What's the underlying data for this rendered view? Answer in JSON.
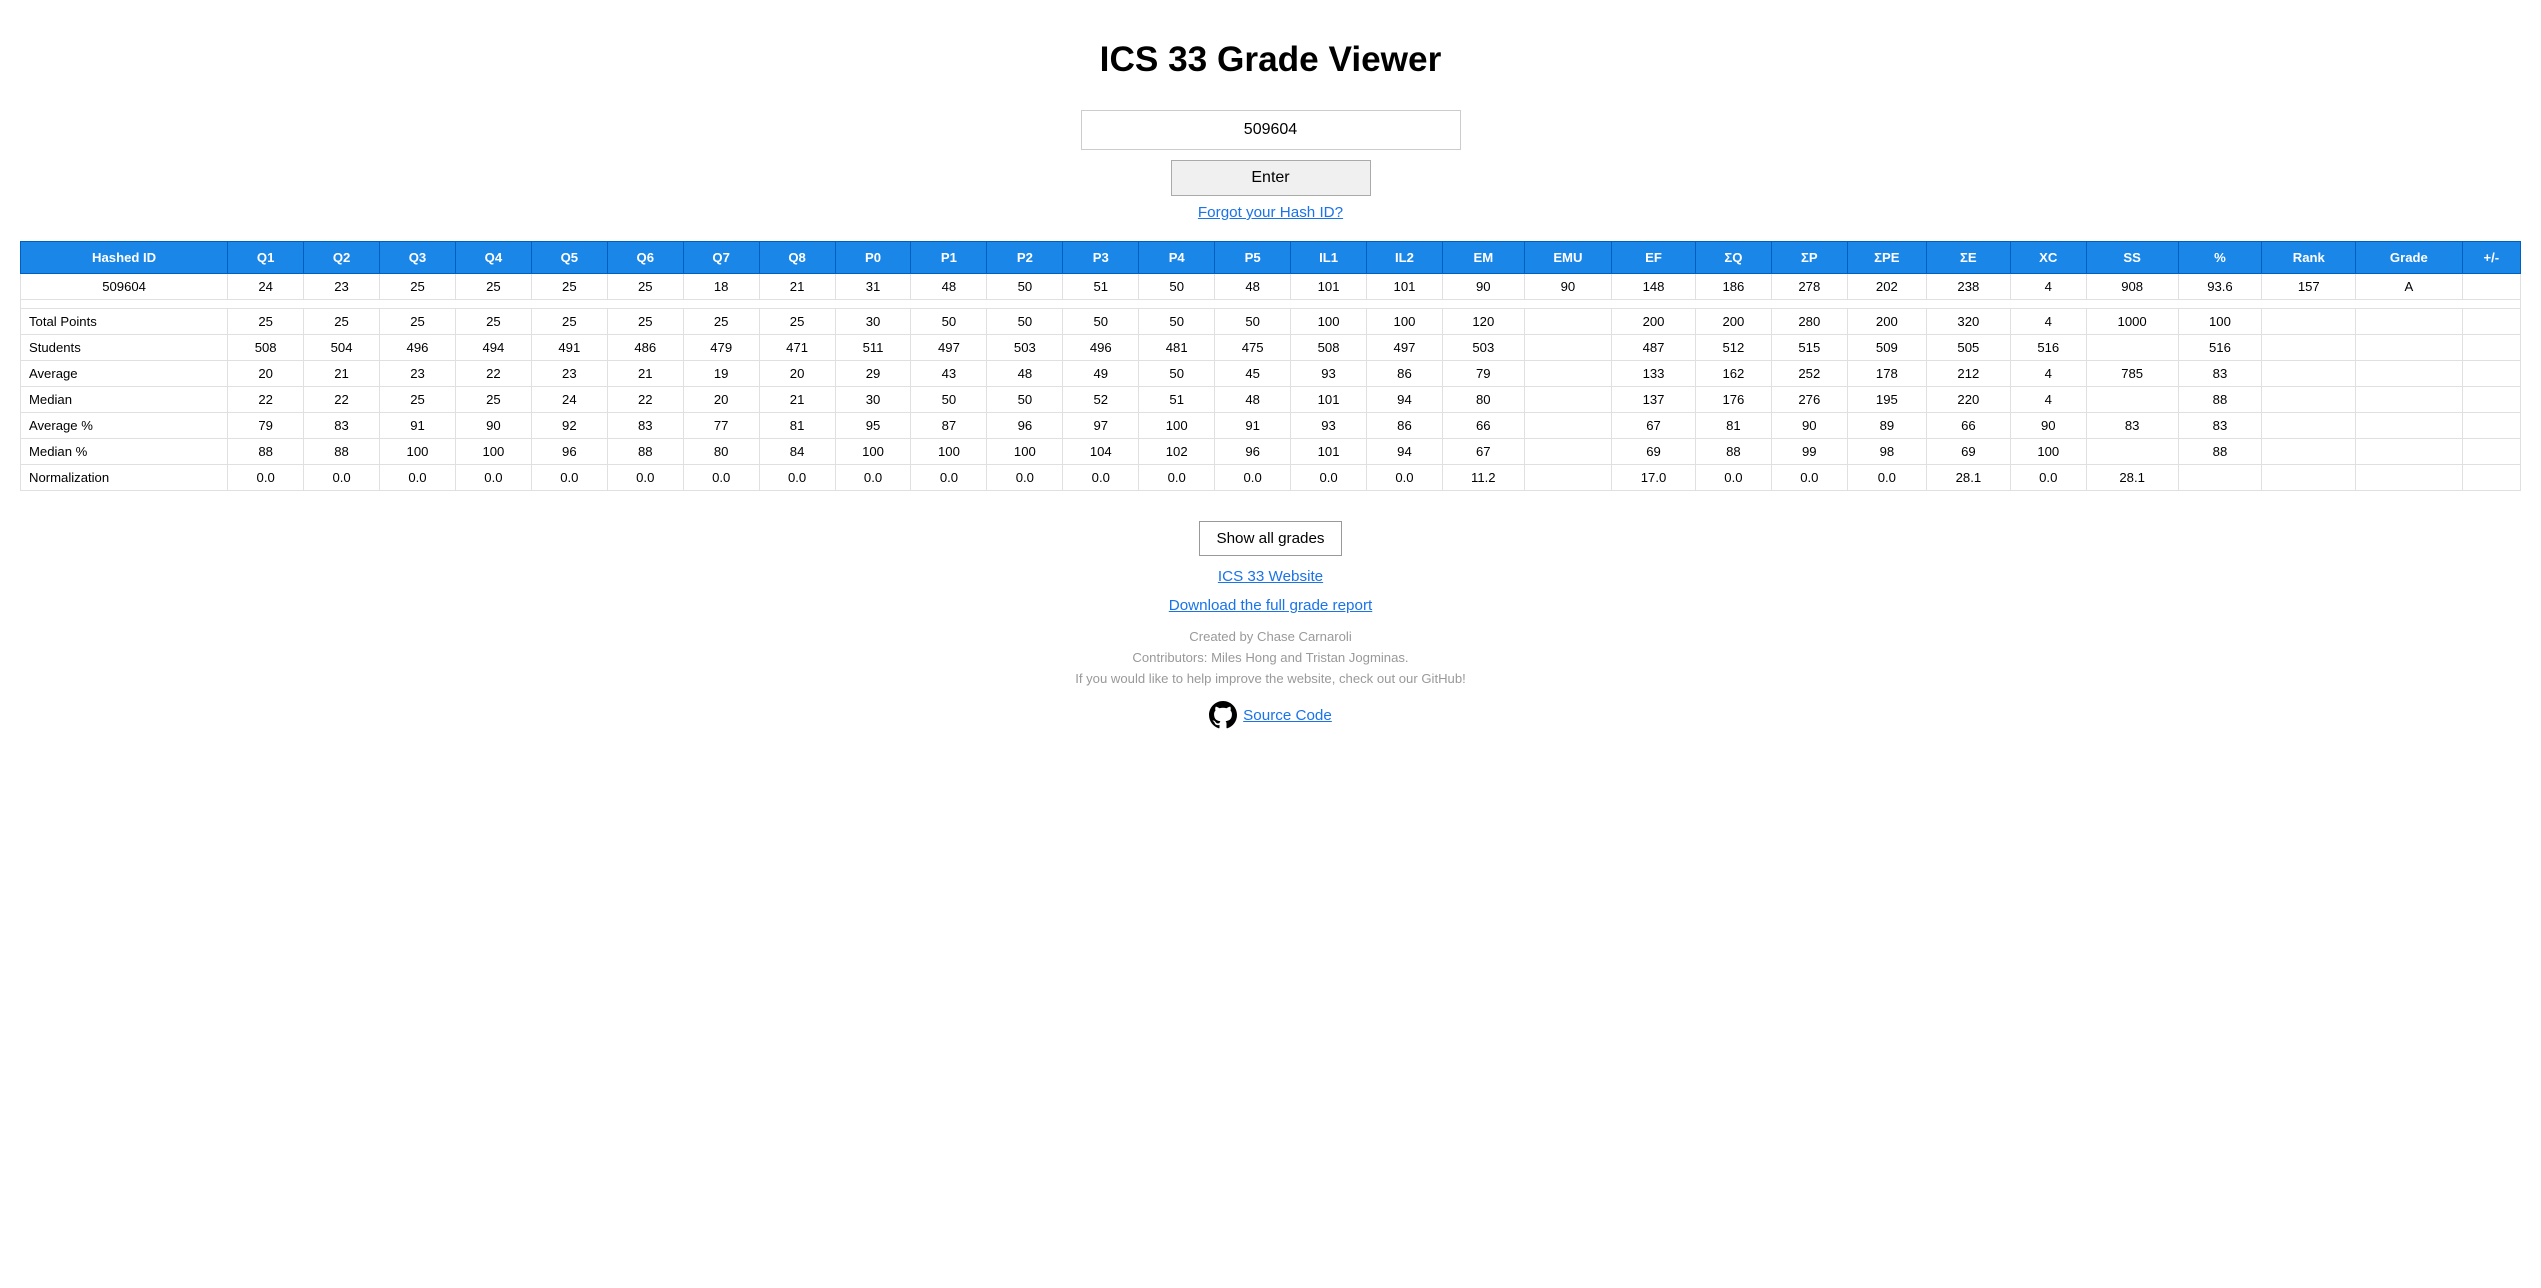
{
  "page": {
    "title": "ICS 33 Grade Viewer"
  },
  "input": {
    "value": "509604",
    "placeholder": ""
  },
  "buttons": {
    "enter": "Enter",
    "show_all": "Show all grades"
  },
  "links": {
    "forgot": "Forgot your Hash ID?",
    "ics_website": "ICS 33 Website",
    "download": "Download the full grade report",
    "source_code": "Source Code"
  },
  "credits": {
    "line1": "Created by Chase Carnaroli",
    "line2": "Contributors: Miles Hong and Tristan Jogminas.",
    "line3": "If you would like to help improve the website, check out our GitHub!"
  },
  "table": {
    "headers": [
      "Hashed ID",
      "Q1",
      "Q2",
      "Q3",
      "Q4",
      "Q5",
      "Q6",
      "Q7",
      "Q8",
      "P0",
      "P1",
      "P2",
      "P3",
      "P4",
      "P5",
      "IL1",
      "IL2",
      "EM",
      "EMU",
      "EF",
      "ΣQ",
      "ΣP",
      "ΣPE",
      "ΣE",
      "XC",
      "SS",
      "%",
      "Rank",
      "Grade",
      "+/-"
    ],
    "student_row": [
      "509604",
      "24",
      "23",
      "25",
      "25",
      "25",
      "25",
      "18",
      "21",
      "31",
      "48",
      "50",
      "51",
      "50",
      "48",
      "101",
      "101",
      "90",
      "90",
      "148",
      "186",
      "278",
      "202",
      "238",
      "4",
      "908",
      "93.6",
      "157",
      "A",
      ""
    ],
    "stats": [
      {
        "label": "Total Points",
        "values": [
          "25",
          "25",
          "25",
          "25",
          "25",
          "25",
          "25",
          "25",
          "30",
          "50",
          "50",
          "50",
          "50",
          "50",
          "100",
          "100",
          "120",
          "",
          "200",
          "200",
          "280",
          "200",
          "320",
          "4",
          "1000",
          "100",
          "",
          "",
          ""
        ]
      },
      {
        "label": "Students",
        "values": [
          "508",
          "504",
          "496",
          "494",
          "491",
          "486",
          "479",
          "471",
          "511",
          "497",
          "503",
          "496",
          "481",
          "475",
          "508",
          "497",
          "503",
          "",
          "487",
          "512",
          "515",
          "509",
          "505",
          "516",
          "",
          "516",
          "",
          "",
          ""
        ]
      },
      {
        "label": "Average",
        "values": [
          "20",
          "21",
          "23",
          "22",
          "23",
          "21",
          "19",
          "20",
          "29",
          "43",
          "48",
          "49",
          "50",
          "45",
          "93",
          "86",
          "79",
          "",
          "133",
          "162",
          "252",
          "178",
          "212",
          "4",
          "785",
          "83",
          "",
          "",
          ""
        ]
      },
      {
        "label": "Median",
        "values": [
          "22",
          "22",
          "25",
          "25",
          "24",
          "22",
          "20",
          "21",
          "30",
          "50",
          "50",
          "52",
          "51",
          "48",
          "101",
          "94",
          "80",
          "",
          "137",
          "176",
          "276",
          "195",
          "220",
          "4",
          "",
          "88",
          "",
          "",
          ""
        ]
      },
      {
        "label": "Average %",
        "values": [
          "79",
          "83",
          "91",
          "90",
          "92",
          "83",
          "77",
          "81",
          "95",
          "87",
          "96",
          "97",
          "100",
          "91",
          "93",
          "86",
          "66",
          "",
          "67",
          "81",
          "90",
          "89",
          "66",
          "90",
          "83",
          "83",
          "",
          "",
          ""
        ]
      },
      {
        "label": "Median %",
        "values": [
          "88",
          "88",
          "100",
          "100",
          "96",
          "88",
          "80",
          "84",
          "100",
          "100",
          "100",
          "104",
          "102",
          "96",
          "101",
          "94",
          "67",
          "",
          "69",
          "88",
          "99",
          "98",
          "69",
          "100",
          "",
          "88",
          "",
          "",
          ""
        ]
      },
      {
        "label": "Normalization",
        "values": [
          "0.0",
          "0.0",
          "0.0",
          "0.0",
          "0.0",
          "0.0",
          "0.0",
          "0.0",
          "0.0",
          "0.0",
          "0.0",
          "0.0",
          "0.0",
          "0.0",
          "0.0",
          "0.0",
          "11.2",
          "",
          "17.0",
          "0.0",
          "0.0",
          "0.0",
          "28.1",
          "0.0",
          "28.1",
          "",
          "",
          "",
          ""
        ]
      }
    ]
  }
}
